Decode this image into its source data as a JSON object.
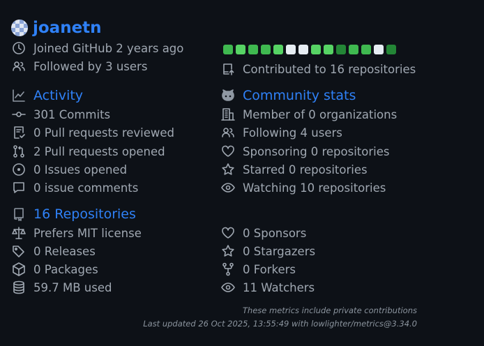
{
  "profile": {
    "username": "joanetn",
    "joined": "Joined GitHub 2 years ago",
    "followers": "Followed by 3 users",
    "contributed": "Contributed to 16 repositories"
  },
  "calendar": {
    "colors": [
      "#3fb950",
      "#56d364",
      "#3fb950",
      "#3fb950",
      "#56d364",
      "#e6edf3",
      "#e6edf3",
      "#56d364",
      "#56d364",
      "#238636",
      "#3fb950",
      "#3fb950",
      "#e6edf3",
      "#238636"
    ]
  },
  "activity": {
    "title": "Activity",
    "items": [
      "301 Commits",
      "0 Pull requests reviewed",
      "2 Pull requests opened",
      "0 Issues opened",
      "0 issue comments"
    ]
  },
  "community": {
    "title": "Community stats",
    "items": [
      "Member of 0 organizations",
      "Following 4 users",
      "Sponsoring 0 repositories",
      "Starred 0 repositories",
      "Watching 10 repositories"
    ]
  },
  "repositories": {
    "title": "16 Repositories",
    "left": [
      "Prefers MIT license",
      "0 Releases",
      "0 Packages",
      "59.7 MB used"
    ],
    "right": [
      "0 Sponsors",
      "0 Stargazers",
      "0 Forkers",
      "11 Watchers"
    ]
  },
  "footer": {
    "line1": "These metrics include private contributions",
    "line2": "Last updated 26 Oct 2025, 13:55:49 with lowlighter/metrics@3.34.0"
  },
  "colors": {
    "accent": "#2f81f7",
    "text": "#a0a8b2",
    "background": "#0d1117"
  }
}
